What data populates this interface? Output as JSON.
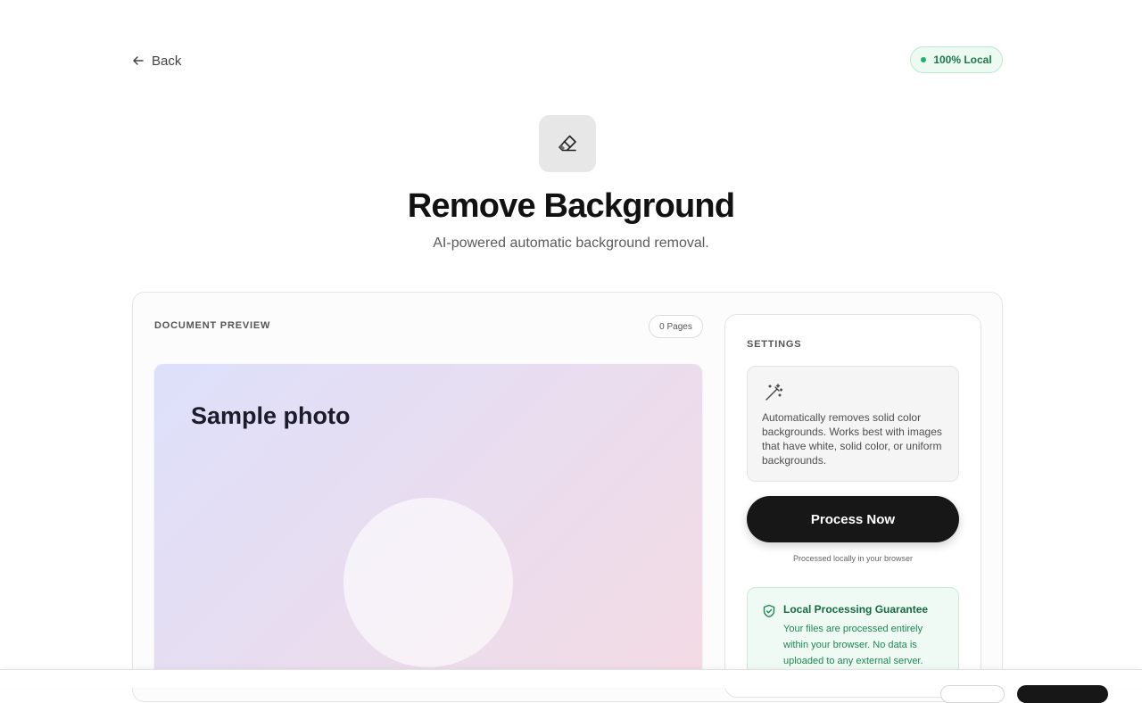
{
  "nav": {
    "back_label": "Back",
    "local_badge": "100% Local",
    "local_badge_color": "#20b26b"
  },
  "header": {
    "icon": "eraser-icon",
    "title": "Remove Background",
    "subtitle": "AI-powered automatic background removal."
  },
  "preview": {
    "label": "DOCUMENT PREVIEW",
    "pages_badge": "0 Pages",
    "sample_title": "Sample photo"
  },
  "settings": {
    "label": "SETTINGS",
    "info_icon": "magic-wand-icon",
    "info_text": "Automatically removes solid color backgrounds. Works best with images that have white, solid color, or uniform backgrounds.",
    "process_button": "Process Now",
    "process_note": "Processed locally in your browser",
    "guarantee": {
      "icon": "shield-check-icon",
      "title": "Local Processing Guarantee",
      "text": "Your files are processed entirely within your browser. No data is uploaded to any external server."
    }
  },
  "colors": {
    "accent_dark": "#171717",
    "success_green": "#146b41",
    "success_bg": "#effaf4"
  }
}
